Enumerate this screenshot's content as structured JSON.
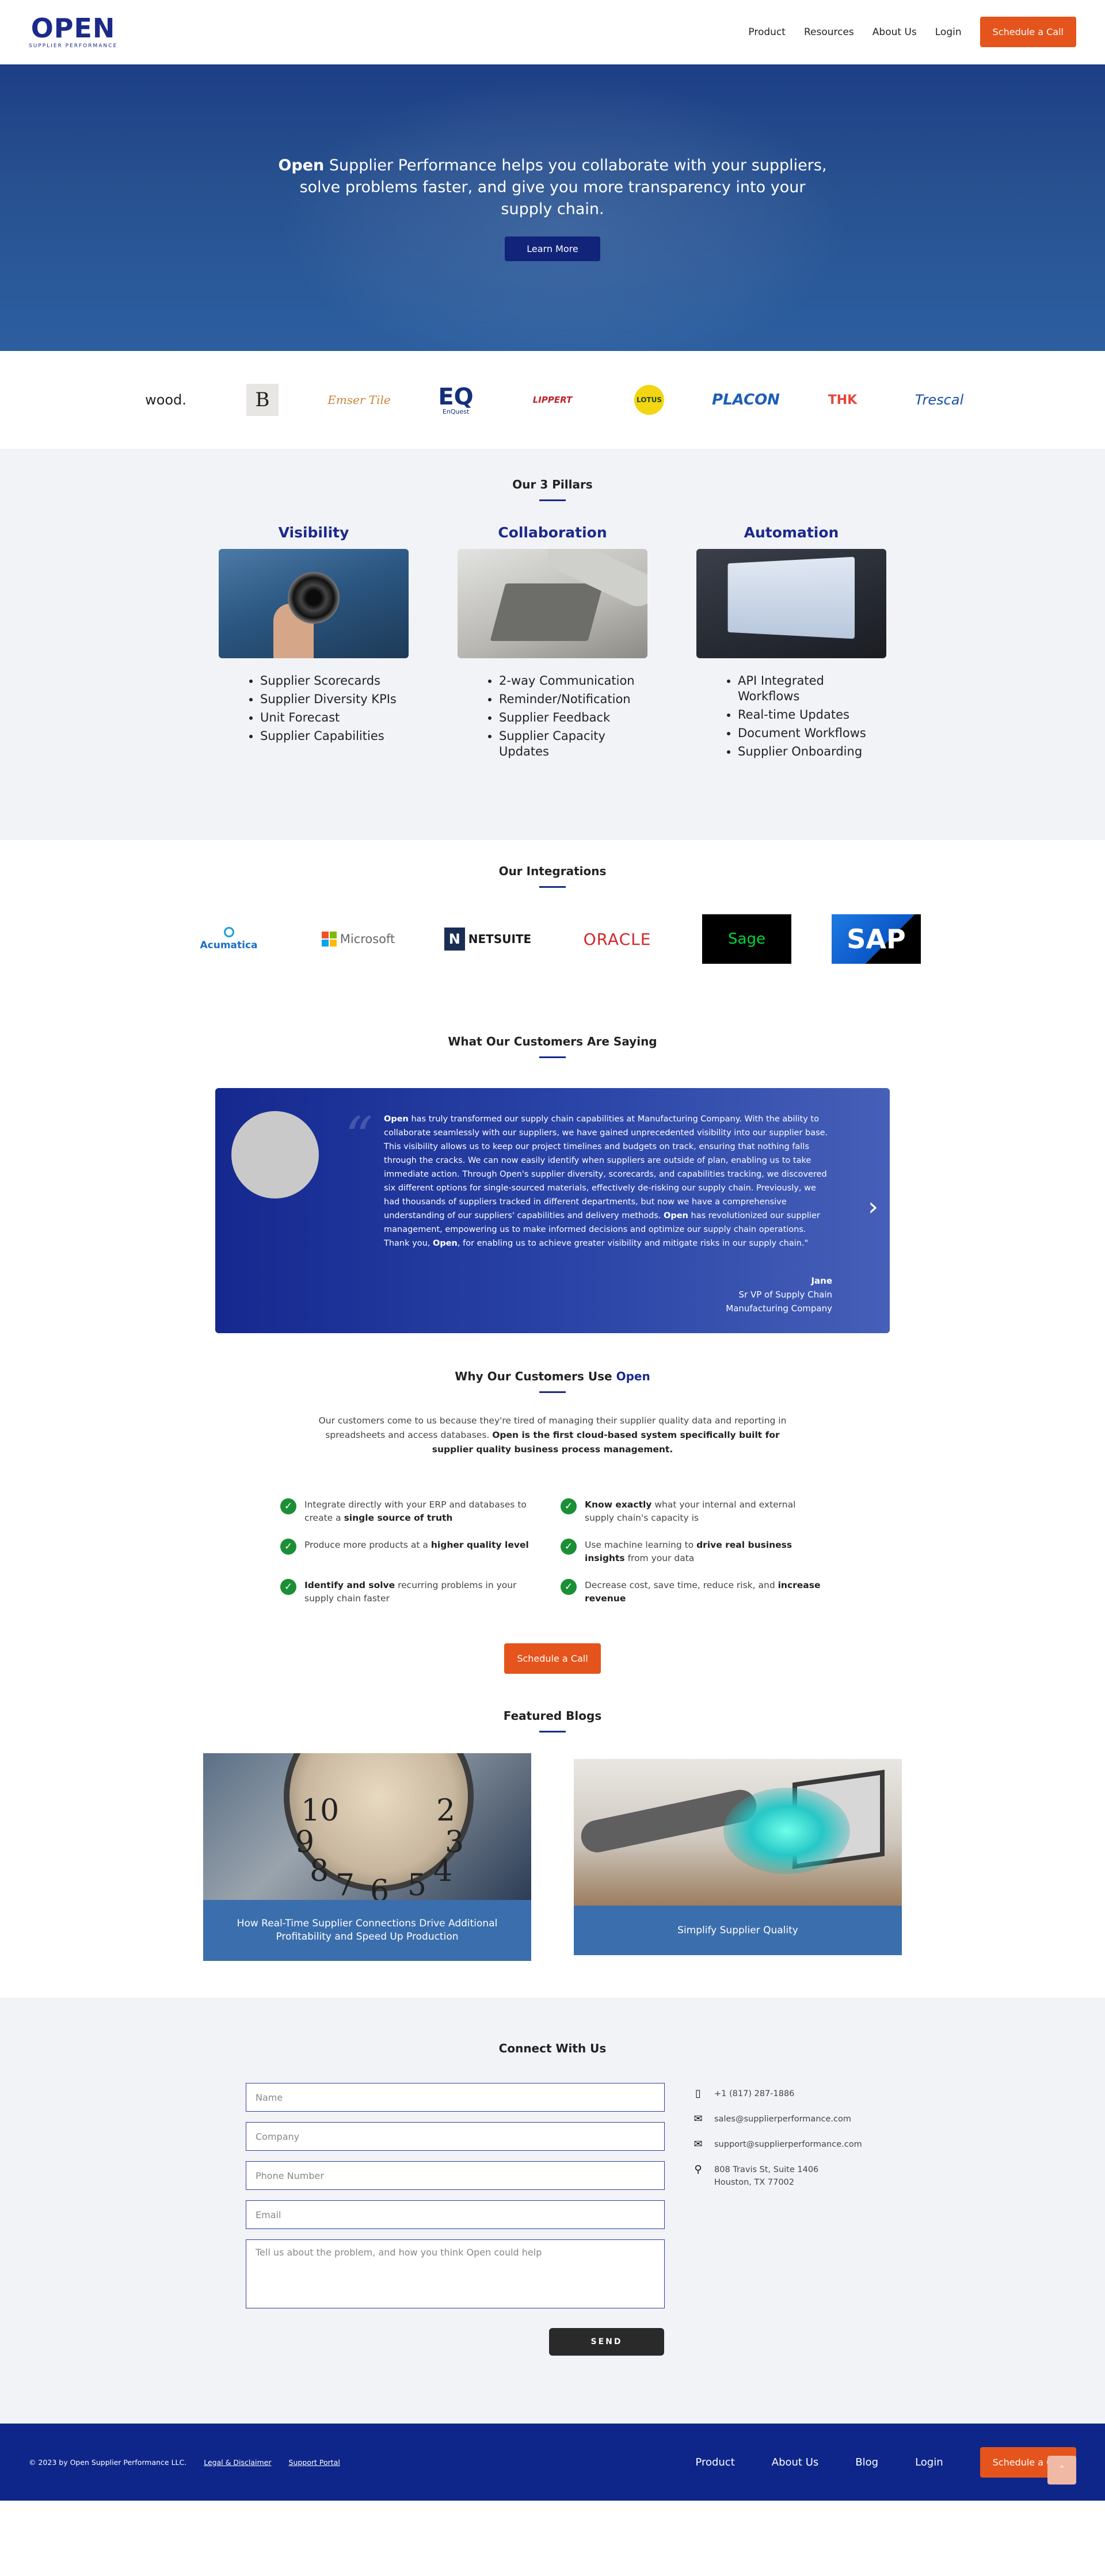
{
  "header": {
    "logo_main": "OPEN",
    "logo_sub": "SUPPLIER PERFORMANCE",
    "nav": [
      "Product",
      "Resources",
      "About Us",
      "Login"
    ],
    "cta": "Schedule a Call"
  },
  "hero": {
    "brand": "Open",
    "text": " Supplier Performance helps you collaborate with your suppliers, solve problems faster, and give you more transparency into your supply chain.",
    "button": "Learn More"
  },
  "clients": {
    "wood": "wood.",
    "b": "B",
    "emser": "Emser Tile",
    "eq": "EQ",
    "eq_sub": "EnQuest",
    "lippert": "LIPPERT",
    "lotus": "LOTUS",
    "placon": "PLACON",
    "thk": "THK",
    "trescal": "Trescal"
  },
  "pillars": {
    "title": "Our 3 Pillars",
    "items": [
      {
        "title": "Visibility",
        "bullets": [
          "Supplier Scorecards",
          "Supplier Diversity KPIs",
          "Unit Forecast",
          "Supplier Capabilities"
        ]
      },
      {
        "title": "Collaboration",
        "bullets": [
          "2-way Communication",
          "Reminder/Notification",
          "Supplier Feedback",
          "Supplier Capacity Updates"
        ]
      },
      {
        "title": "Automation",
        "bullets": [
          "API Integrated Workflows",
          "Real-time Updates",
          "Document Workflows",
          "Supplier Onboarding"
        ]
      }
    ]
  },
  "integrations": {
    "title": "Our Integrations",
    "acumatica": "Acumatica",
    "microsoft": "Microsoft",
    "netsuite": "NETSUITE",
    "netsuite_n": "N",
    "oracle": "ORACLE",
    "sage": "Sage",
    "sap": "SAP"
  },
  "testimonial": {
    "title": "What Our Customers Are Saying",
    "p1_brand": "Open",
    "p1": " has truly transformed our supply chain capabilities at Manufacturing Company. With the ability to collaborate seamlessly with our suppliers, we have gained unprecedented visibility into our supplier base. This visibility allows us to keep our project timelines and budgets on track, ensuring that nothing falls through the cracks. We can now easily identify when suppliers are outside of plan, enabling us to take immediate action. Through Open's supplier diversity, scorecards, and capabilities tracking, we discovered six different options for single-sourced materials, effectively de-risking our supply chain. Previously, we had thousands of suppliers tracked in different departments, but now we have a comprehensive understanding of our suppliers' capabilities and delivery methods. ",
    "p2_brand": "Open",
    "p2": " has revolutionized our supplier management, empowering us to make informed decisions and optimize our supply chain operations. Thank you, ",
    "p3_brand": "Open",
    "p3": ", for enabling us to achieve greater visibility and mitigate risks in our supply chain.\"",
    "author": "Jane",
    "role": "Sr VP of Supply Chain",
    "company": "Manufacturing Company"
  },
  "why": {
    "title_prefix": "Why Our Customers Use ",
    "title_brand": "Open",
    "intro": "Our customers come to us because they're tired of managing their supplier quality data and reporting in spreadsheets and access databases. ",
    "intro_bold": "Open is the first cloud-based system specifically built for supplier quality business process management.",
    "items": [
      {
        "pre": "Integrate directly with your ERP and databases to create a ",
        "bold": "single source of truth",
        "post": ""
      },
      {
        "pre": "",
        "bold": "Know exactly",
        "post": " what your internal and external supply chain's capacity is"
      },
      {
        "pre": "Produce more products at a ",
        "bold": "higher quality level",
        "post": ""
      },
      {
        "pre": "Use machine learning to ",
        "bold": "drive real business insights",
        "post": " from your data"
      },
      {
        "pre": "",
        "bold": "Identify and solve",
        "post": " recurring problems in your supply chain faster"
      },
      {
        "pre": "Decrease cost, save time, reduce risk, and ",
        "bold": "increase revenue",
        "post": ""
      }
    ],
    "cta": "Schedule a Call"
  },
  "blogs": {
    "title": "Featured Blogs",
    "items": [
      {
        "caption": "How Real-Time Supplier Connections Drive Additional Profitability and Speed Up Production"
      },
      {
        "caption": "Simplify Supplier Quality"
      }
    ],
    "clock_nums": [
      "10",
      "2",
      "9",
      "3",
      "8",
      "4",
      "7",
      "5",
      "6"
    ]
  },
  "contact": {
    "title": "Connect With Us",
    "fields": [
      "Name",
      "Company",
      "Phone Number",
      "Email"
    ],
    "message": "Tell us about the problem, and how you think Open could help",
    "send": "SEND",
    "phone": "+1 (817) 287-1886",
    "email_sales": "sales@supplierperformance.com",
    "email_support": "support@supplierperformance.com",
    "address1": "808 Travis St, Suite 1406",
    "address2": "Houston, TX 77002"
  },
  "footer": {
    "copyright": "© 2023 by Open Supplier Performance LLC.",
    "legal": "Legal & Disclaimer",
    "support": "Support Portal",
    "nav": [
      "Product",
      "About Us",
      "Blog",
      "Login"
    ],
    "cta": "Schedule a Call"
  },
  "colors": {
    "brand": "#1b2a8a",
    "accent": "#e4541c",
    "success": "#1b8f35"
  }
}
